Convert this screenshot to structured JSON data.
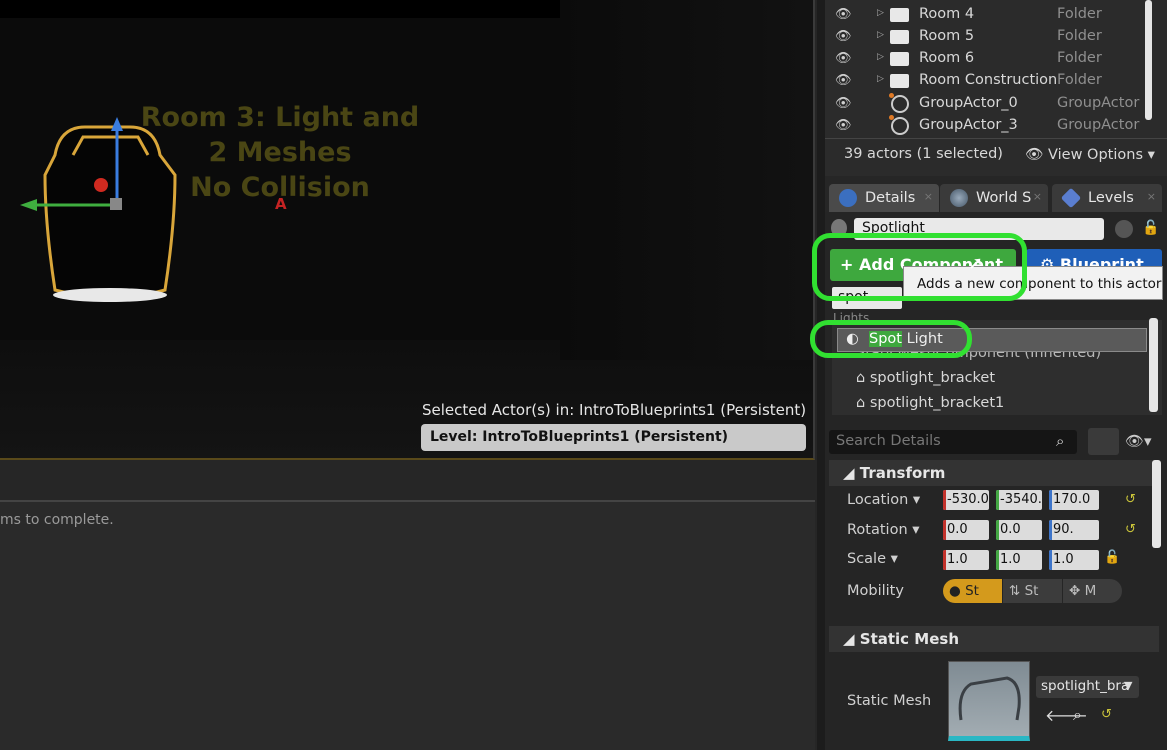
{
  "viewport": {
    "room_text": [
      "Room 3: Light and",
      "2 Meshes",
      "No Collision"
    ],
    "selected_actors_text": "Selected Actor(s) in:  IntroToBlueprints1 (Persistent)",
    "level_text": "Level:  IntroToBlueprints1 (Persistent)",
    "marker": "A"
  },
  "lower_panel": {
    "message": "ms to complete."
  },
  "outliner": {
    "rows": [
      {
        "name": "Room 4",
        "type": "Folder",
        "kind": "folder"
      },
      {
        "name": "Room 5",
        "type": "Folder",
        "kind": "folder"
      },
      {
        "name": "Room 6",
        "type": "Folder",
        "kind": "folder"
      },
      {
        "name": "Room Construction",
        "type": "Folder",
        "kind": "folder"
      },
      {
        "name": "GroupActor_0",
        "type": "GroupActor",
        "kind": "group"
      },
      {
        "name": "GroupActor_3",
        "type": "GroupActor",
        "kind": "group"
      }
    ],
    "actors_count": "39 actors (1 selected)",
    "view_options": "View Options"
  },
  "tabs": [
    {
      "label": "Details",
      "icon": "info-icon"
    },
    {
      "label": "World S",
      "icon": "globe-icon"
    },
    {
      "label": "Levels",
      "icon": "levels-icon"
    }
  ],
  "details": {
    "actor_name": "Spotlight",
    "add_component_label": "+ Add Component",
    "blueprint_label": "Blueprint",
    "tooltip": "Adds a new component to this actor",
    "component_search": "spot",
    "lights_header": "Lights",
    "spot_light_match": "Spot",
    "spot_light_rest": " Light",
    "components": [
      "StaticMeshComponent (Inherited)",
      "spotlight_bracket",
      "spotlight_bracket1"
    ],
    "search_placeholder": "Search Details",
    "transform_header": "Transform",
    "location_label": "Location",
    "rotation_label": "Rotation",
    "scale_label": "Scale",
    "mobility_label": "Mobility",
    "location": [
      "-530.0",
      "-3540.",
      "170.0"
    ],
    "rotation": [
      "0.0",
      "0.0",
      "90."
    ],
    "scale": [
      "1.0",
      "1.0",
      "1.0"
    ],
    "mobility": [
      "St",
      "St",
      "M"
    ],
    "static_mesh_header": "Static Mesh",
    "static_mesh_label": "Static Mesh",
    "static_mesh_value": "spotlight_bra"
  },
  "colors": {
    "add_green": "#3ea83e",
    "blueprint_blue": "#1f5fb8",
    "highlight_ring": "#31e031",
    "mobility_static": "#d49a1c"
  }
}
